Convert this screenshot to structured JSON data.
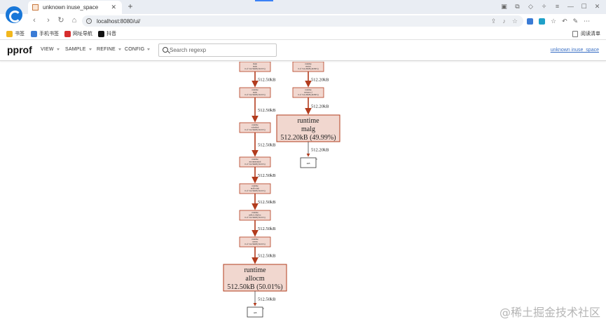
{
  "browser": {
    "tab_title": "unknown inuse_space",
    "url": "localhost:8080/ui/",
    "bookmarks": [
      "书签",
      "手机书签",
      "网址导航",
      "抖音"
    ],
    "reading_list": "阅读清单"
  },
  "pprof": {
    "title": "pprof",
    "menus": [
      "VIEW",
      "SAMPLE",
      "REFINE",
      "CONFIG"
    ],
    "search_placeholder": "Search regexp",
    "profile_link": "unknown inuse_space"
  },
  "graph": {
    "left_chain": [
      {
        "name": "main",
        "func": "main",
        "detail": "0 of 512.50kB (50.01%)"
      },
      {
        "name": "runtime",
        "func": "main",
        "detail": "0 of 512.50kB (50.01%)"
      },
      {
        "name": "runtime",
        "func": "schedinit",
        "detail": "0 of 512.50kB (50.01%)"
      },
      {
        "name": "runtime",
        "func": "mcommoninit",
        "detail": "0 of 512.50kB (50.01%)"
      },
      {
        "name": "runtime",
        "func": "mallocinit",
        "detail": "0 of 512.50kB (50.01%)"
      },
      {
        "name": "runtime",
        "func": "mProf_Malloc",
        "detail": "0 of 512.50kB (50.01%)"
      },
      {
        "name": "runtime",
        "func": "newm",
        "detail": "0 of 512.50kB (50.01%)"
      }
    ],
    "left_edges": [
      "512.50kB",
      "512.50kB",
      "512.50kB",
      "512.50kB",
      "512.50kB",
      "512.50kB",
      "512.50kB"
    ],
    "left_leaf": {
      "name": "runtime",
      "func": "allocm",
      "value": "512.50kB (50.01%)"
    },
    "left_final_edge": "512.50kB",
    "left_sink": "1kB",
    "right_chain": [
      {
        "name": "runtime",
        "func": "mstart",
        "detail": "0 of 512.20kB (49.99%)"
      },
      {
        "name": "runtime",
        "func": "newproc1",
        "detail": "0 of 512.20kB (49.99%)"
      }
    ],
    "right_edges": [
      "512.20kB",
      "512.20kB"
    ],
    "right_leaf": {
      "name": "runtime",
      "func": "malg",
      "value": "512.20kB (49.99%)"
    },
    "right_final_edge": "512.20kB",
    "right_sink": "4kB"
  },
  "watermark": "@稀土掘金技术社区",
  "colors": {
    "node_fill": "#f1d7cf",
    "node_stroke": "#b23c1e",
    "edge": "#b23c1e",
    "link": "#3a6fc4"
  }
}
